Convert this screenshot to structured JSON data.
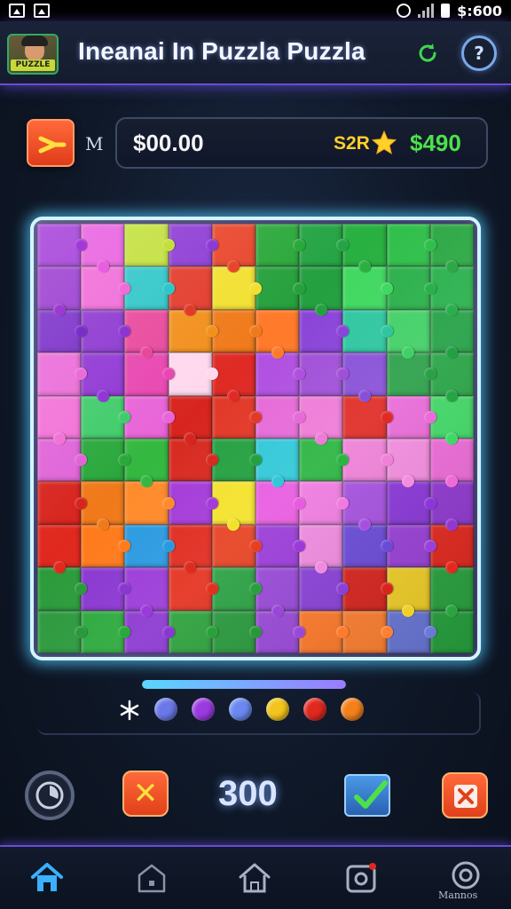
{
  "status_bar": {
    "time": "$:600"
  },
  "header": {
    "logo_text": "PUZZLE",
    "title": "Ineanai In Puzzla Puzzla",
    "help_symbol": "?"
  },
  "score_row": {
    "mode_label": "M",
    "score": "$00.00",
    "rank": "S2R",
    "coins": "$490"
  },
  "board": {
    "rows": 10,
    "cols": 10,
    "tiles": [
      "#a23ad8",
      "#e85ee0",
      "#c2e03a",
      "#8c3ad4",
      "#e8452a",
      "#2aa83a",
      "#24a444",
      "#28b040",
      "#2fbf4a",
      "#2ca844",
      "#9a3ad0",
      "#f06ad8",
      "#2ec6c8",
      "#e23a2a",
      "#f2e030",
      "#26a03c",
      "#24a040",
      "#40d860",
      "#2ab04a",
      "#28b04c",
      "#7a2ec8",
      "#8c36d0",
      "#e8489c",
      "#f2901c",
      "#f07a1a",
      "#ff7a2a",
      "#8a44d8",
      "#2ec6a0",
      "#40d066",
      "#22a044",
      "#ea6cd8",
      "#9036d4",
      "#e846b0",
      "#ffd8ee",
      "#e02a24",
      "#b050e0",
      "#a050d8",
      "#8850d8",
      "#2aa048",
      "#26a444",
      "#f272d8",
      "#40cc6a",
      "#e864d8",
      "#d8241e",
      "#e23828",
      "#e66ad8",
      "#ef7ad8",
      "#e02a24",
      "#ea6ad8",
      "#40d866",
      "#e064d8",
      "#2aa83c",
      "#34b840",
      "#d82a20",
      "#24a040",
      "#30c8d8",
      "#2ab440",
      "#f080d8",
      "#f48ce0",
      "#ee6ad8",
      "#d8241e",
      "#f07a1a",
      "#ff8a2a",
      "#a43ad8",
      "#f4e22a",
      "#e85ae0",
      "#f07ae0",
      "#a650e0",
      "#8a36d8",
      "#9038d0",
      "#e0281e",
      "#ff7a1a",
      "#2a9ae0",
      "#e02a1e",
      "#e64020",
      "#9a3ad8",
      "#f08ae0",
      "#6a4ad8",
      "#9a40d8",
      "#e4281e",
      "#2a9a3a",
      "#8a36d0",
      "#9a3ad8",
      "#e4301e",
      "#28a040",
      "#9848d8",
      "#8a40d8",
      "#d8241e",
      "#f2d028",
      "#2aa440",
      "#2a983c",
      "#2aa83c",
      "#8a36d0",
      "#2aa03a",
      "#26983a",
      "#9a48d8",
      "#ff7a2a",
      "#ff8030",
      "#6a78d8",
      "#28a440"
    ]
  },
  "progress": 1.0,
  "color_options": [
    "#6a78e8",
    "#9a3ae0",
    "#6a88f0",
    "#f2c41c",
    "#e0281e",
    "#f4801a"
  ],
  "controls": {
    "close_symbol": "✕",
    "moves": "300"
  },
  "bottom_nav": {
    "items": [
      "home-icon",
      "house-icon",
      "house-outline-icon",
      "camera-icon",
      "settings-icon"
    ],
    "settings_label": "Mannos"
  },
  "colors": {
    "accent": "#6a4bd6",
    "board_glow": "#50c8ff",
    "coins": "#4be24a",
    "rank": "#ffcf2a",
    "active_nav": "#3ab0ff"
  }
}
